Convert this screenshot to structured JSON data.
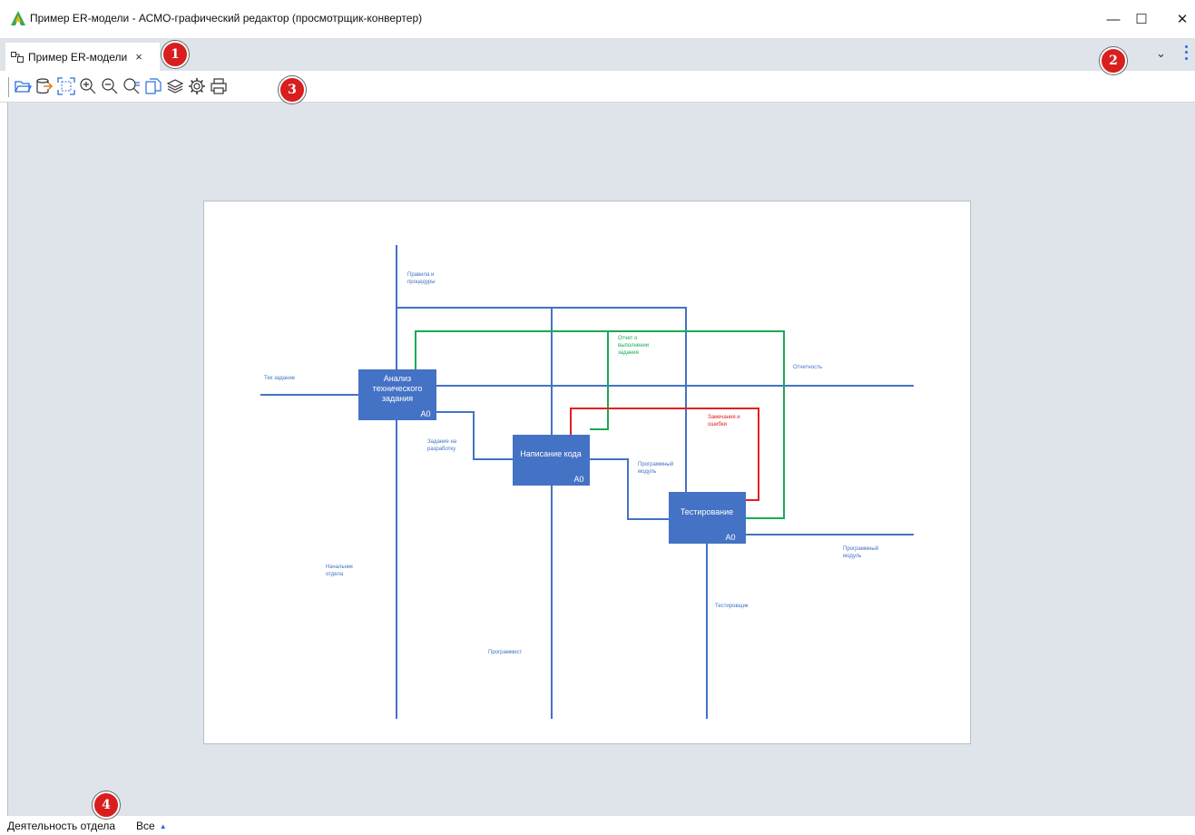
{
  "window": {
    "title": "Пример ER-модели - АСМО-графический редактор (просмотрщик-конвертер)",
    "min_glyph": "—",
    "max_glyph": "☐",
    "close_glyph": "✕"
  },
  "tabs": [
    {
      "label": "Пример ER-модели",
      "close_glyph": "×"
    }
  ],
  "tabstrip": {
    "chevron_glyph": "⌄"
  },
  "toolbar": {
    "icons": [
      "open-folder-icon",
      "export-db-icon",
      "fit-page-icon",
      "zoom-in-icon",
      "zoom-out-icon",
      "zoom-fit-icon",
      "copy-page-icon",
      "layers-icon",
      "settings-icon",
      "print-icon"
    ]
  },
  "markers": [
    "1",
    "2",
    "3",
    "4"
  ],
  "bottom": {
    "sheet_tab": "Деятельность отдела",
    "filter_value": "Все",
    "filter_arrow": "▲"
  },
  "diagram": {
    "colors": {
      "blue": "#4472c4",
      "green": "#1aaa55",
      "red": "#e02020",
      "box": "#4472c4",
      "box_text": "#ffffff"
    },
    "boxes": [
      {
        "text": [
          "Анализ",
          "технического",
          "задания"
        ],
        "code": "A0"
      },
      {
        "text": [
          "Написание кода"
        ],
        "code": "A0"
      },
      {
        "text": [
          "Тестирование"
        ],
        "code": "A0"
      }
    ],
    "labels": {
      "rules": [
        "Правила и",
        "процедуры"
      ],
      "tz": [
        "Тех задание"
      ],
      "report_done": [
        "Отчет о",
        "выполнении",
        "задания"
      ],
      "reporting": [
        "Отчетность"
      ],
      "remarks": [
        "Замечания и",
        "ошибки"
      ],
      "dev_task": [
        "Задание на",
        "разработку"
      ],
      "prog_module_1": [
        "Программный",
        "модуль"
      ],
      "prog_module_2": [
        "Программный",
        "модуль"
      ],
      "head": [
        "Начальник",
        "отдела"
      ],
      "tester": [
        "Тестировщик"
      ],
      "programmer": [
        "Программист"
      ]
    }
  }
}
